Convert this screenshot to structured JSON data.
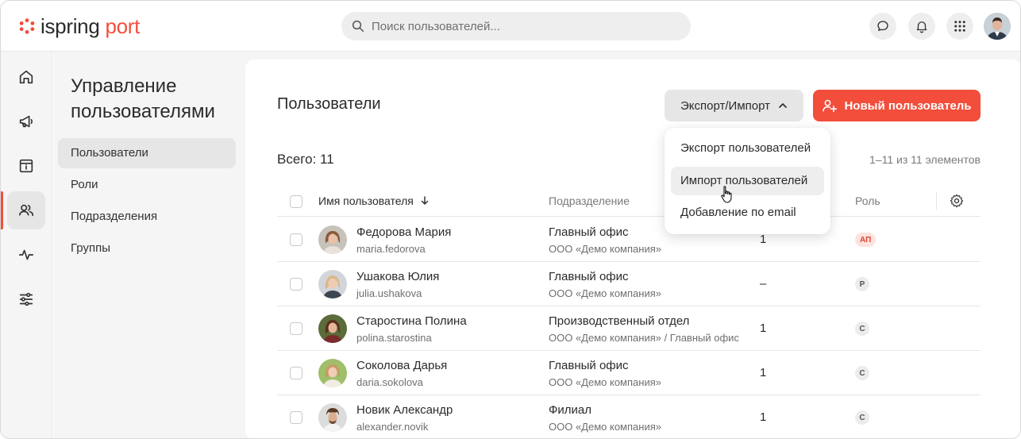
{
  "app": {
    "logo_main": "ispring",
    "logo_accent": "port"
  },
  "search": {
    "placeholder": "Поиск пользователей..."
  },
  "subnav": {
    "title": "Управление пользователями",
    "items": [
      {
        "label": "Пользователи",
        "active": true
      },
      {
        "label": "Роли"
      },
      {
        "label": "Подразделения"
      },
      {
        "label": "Группы"
      }
    ]
  },
  "page": {
    "title": "Пользователи",
    "export_import_label": "Экспорт/Импорт",
    "new_user_label": "Новый пользователь",
    "total_label": "Всего: 11",
    "range_label": "1–11 из 11 элементов"
  },
  "dropdown": {
    "items": [
      {
        "label": "Экспорт пользователей"
      },
      {
        "label": "Импорт пользователей",
        "hover": true
      },
      {
        "label": "Добавление по email"
      }
    ]
  },
  "table": {
    "headers": {
      "user": "Имя пользователя",
      "department": "Подразделение",
      "role": "Роль"
    },
    "rows": [
      {
        "name": "Федорова Мария",
        "login": "maria.fedorova",
        "department": "Главный офис",
        "org": "ООО «Демо компания»",
        "count": "1",
        "role": "АП"
      },
      {
        "name": "Ушакова Юлия",
        "login": "julia.ushakova",
        "department": "Главный офис",
        "org": "ООО «Демо компания»",
        "count": "–",
        "role": "Р"
      },
      {
        "name": "Старостина Полина",
        "login": "polina.starostina",
        "department": "Производственный отдел",
        "org": "ООО «Демо компания» / Главный офис",
        "count": "1",
        "role": "С"
      },
      {
        "name": "Соколова Дарья",
        "login": "daria.sokolova",
        "department": "Главный офис",
        "org": "ООО «Демо компания»",
        "count": "1",
        "role": "С"
      },
      {
        "name": "Новик Александр",
        "login": "alexander.novik",
        "department": "Филиал",
        "org": "ООО «Демо компания»",
        "count": "1",
        "role": "С"
      }
    ]
  },
  "colors": {
    "accent": "#f24e3b",
    "sidebar_bg": "#f5f5f5",
    "active_bg": "#e6e6e6"
  }
}
